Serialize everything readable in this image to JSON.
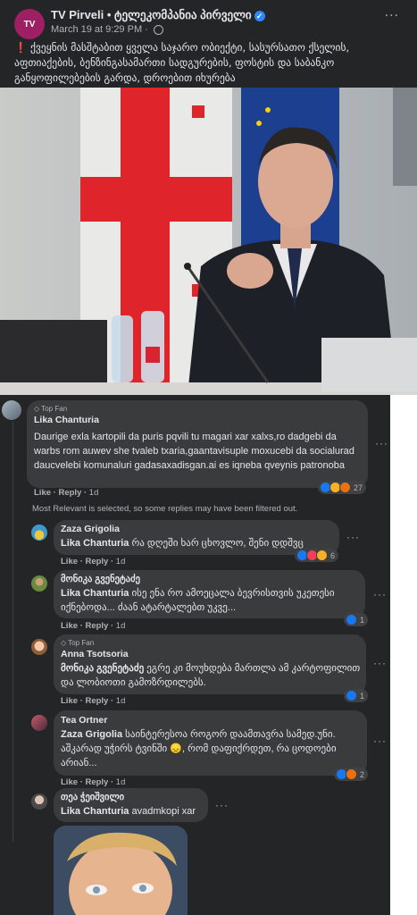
{
  "post": {
    "page_name": "TV Pirveli • ტელეკომპანია პირველი",
    "avatar_text": "TV",
    "timestamp": "March 19 at 9:29 PM",
    "more": "···",
    "text": "ქვეყნის მასშტაბით ყველა საჯარო ობიექტი, სასურსათო ქსელის, აფთიაქების, ბენზინგასამართი სადგურების, ფოსტის და საბანკო განყოფილებების გარდა, დროებით იხურება",
    "exclaim": "❗"
  },
  "comments": [
    {
      "author": "Lika Chanturia",
      "badge": "Top Fan",
      "text": "Daurige exla kartopili da puris pqvili tu magari xar xalxs,ro dadgebi da warbs rom auwev she tvaleb txaria,gaantavisuple moxucebi da socialurad daucvelebi komunaluri gadasaxadisgan.ai es iqneba qveynis patronoba",
      "like": "Like",
      "reply": "Reply",
      "time": "1d",
      "reactions": "27"
    },
    {
      "author": "Zaza Grigolia",
      "tag": "Lika Chanturia",
      "text": "რა დღეში ხარ ცხოვლო, შენი დდშვც",
      "like": "Like",
      "reply": "Reply",
      "time": "1d",
      "reactions": "6"
    },
    {
      "author": "მონიკა გვენეტაძე",
      "tag": "Lika Chanturia",
      "text": "ისე ენა რო ამოეცალა ბევრისთვის უკეთესი იქნებოდა... ძაან ატარტალებთ უკვე...",
      "like": "Like",
      "reply": "Reply",
      "time": "1d",
      "reactions": "1"
    },
    {
      "author": "Anna Tsotsoria",
      "badge": "Top Fan",
      "tag": "მონიკა გვენეტაძე",
      "text": "ეგრე კი მოუხდება მართლა ამ კარტოფილით და ლობიოთი გამოზრდილებს.",
      "like": "Like",
      "reply": "Reply",
      "time": "1d",
      "reactions": "1"
    },
    {
      "author": "Tea Ortner",
      "tag": "Zaza Grigolia",
      "text": "საინტერესოა როგორ დაამთავრა სამედ.უნი. აშკარად უჭირს ტვინში 😞, რომ დაფიქრდეთ, რა ცოდოები არიან...",
      "like": "Like",
      "reply": "Reply",
      "time": "1d",
      "reactions": "2"
    },
    {
      "author": "თეა ჭეიშვილი",
      "tag": "Lika Chanturia",
      "text": "avadmkopi xar"
    }
  ],
  "filter_note": "Most Relevant is selected, so some replies may have been filtered out.",
  "colors": {
    "background": "#242526",
    "bubble": "#3a3b3c",
    "text": "#e4e6eb",
    "muted": "#b0b3b8",
    "brand": "#9e1f63"
  }
}
